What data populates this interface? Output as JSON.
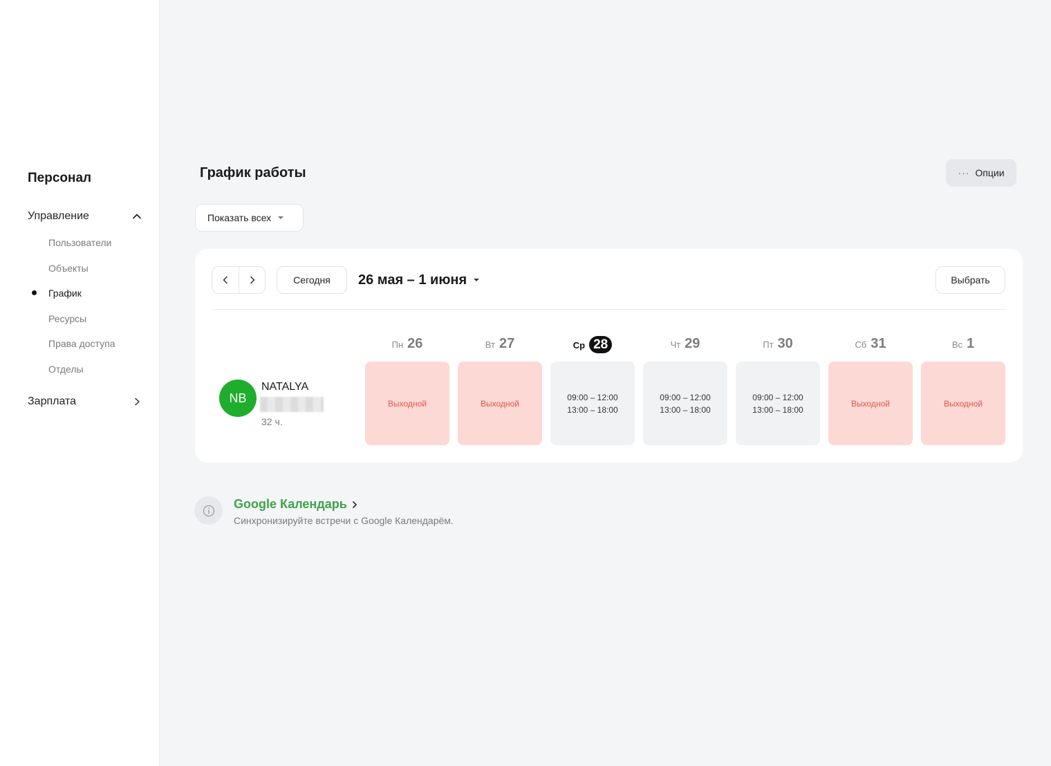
{
  "sidebar": {
    "title": "Персонал",
    "groups": [
      {
        "label": "Управление",
        "expanded": true,
        "icon": "chevron-up-icon"
      },
      {
        "label": "Зарплата",
        "expanded": false,
        "icon": "chevron-right-icon"
      }
    ],
    "items": [
      {
        "label": "Пользователи"
      },
      {
        "label": "Объекты"
      },
      {
        "label": "График",
        "active": true
      },
      {
        "label": "Ресурсы"
      },
      {
        "label": "Права доступа"
      },
      {
        "label": "Отделы"
      }
    ]
  },
  "header": {
    "title": "График работы",
    "options_label": "Опции"
  },
  "filter": {
    "show_all_label": "Показать всех"
  },
  "calendar": {
    "today_label": "Сегодня",
    "range_label": "26 мая – 1 июня",
    "select_label": "Выбрать",
    "days": [
      {
        "name": "Пн",
        "date": "26"
      },
      {
        "name": "Вт",
        "date": "27"
      },
      {
        "name": "Ср",
        "date": "28",
        "current": true
      },
      {
        "name": "Чт",
        "date": "29"
      },
      {
        "name": "Пт",
        "date": "30"
      },
      {
        "name": "Сб",
        "date": "31"
      },
      {
        "name": "Вс",
        "date": "1"
      }
    ],
    "employee": {
      "initials": "NB",
      "name": "NATALYA",
      "hours": "32 ч.",
      "avatar_color": "#1fad2d"
    },
    "shifts": [
      {
        "type": "off",
        "label": "Выходной"
      },
      {
        "type": "off",
        "label": "Выходной"
      },
      {
        "type": "work",
        "slots": [
          "09:00 – 12:00",
          "13:00 – 18:00"
        ]
      },
      {
        "type": "work",
        "slots": [
          "09:00 – 12:00",
          "13:00 – 18:00"
        ]
      },
      {
        "type": "work",
        "slots": [
          "09:00 – 12:00",
          "13:00 – 18:00"
        ]
      },
      {
        "type": "off",
        "label": "Выходной"
      },
      {
        "type": "off",
        "label": "Выходной"
      }
    ]
  },
  "integration": {
    "link_label": "Google Календарь",
    "description": "Синхронизируйте встречи с Google Календарём.",
    "link_color": "#3fa24a"
  },
  "colors": {
    "off_bg": "#fcd9d5",
    "off_text": "#e4564a",
    "work_bg": "#f1f2f4"
  }
}
